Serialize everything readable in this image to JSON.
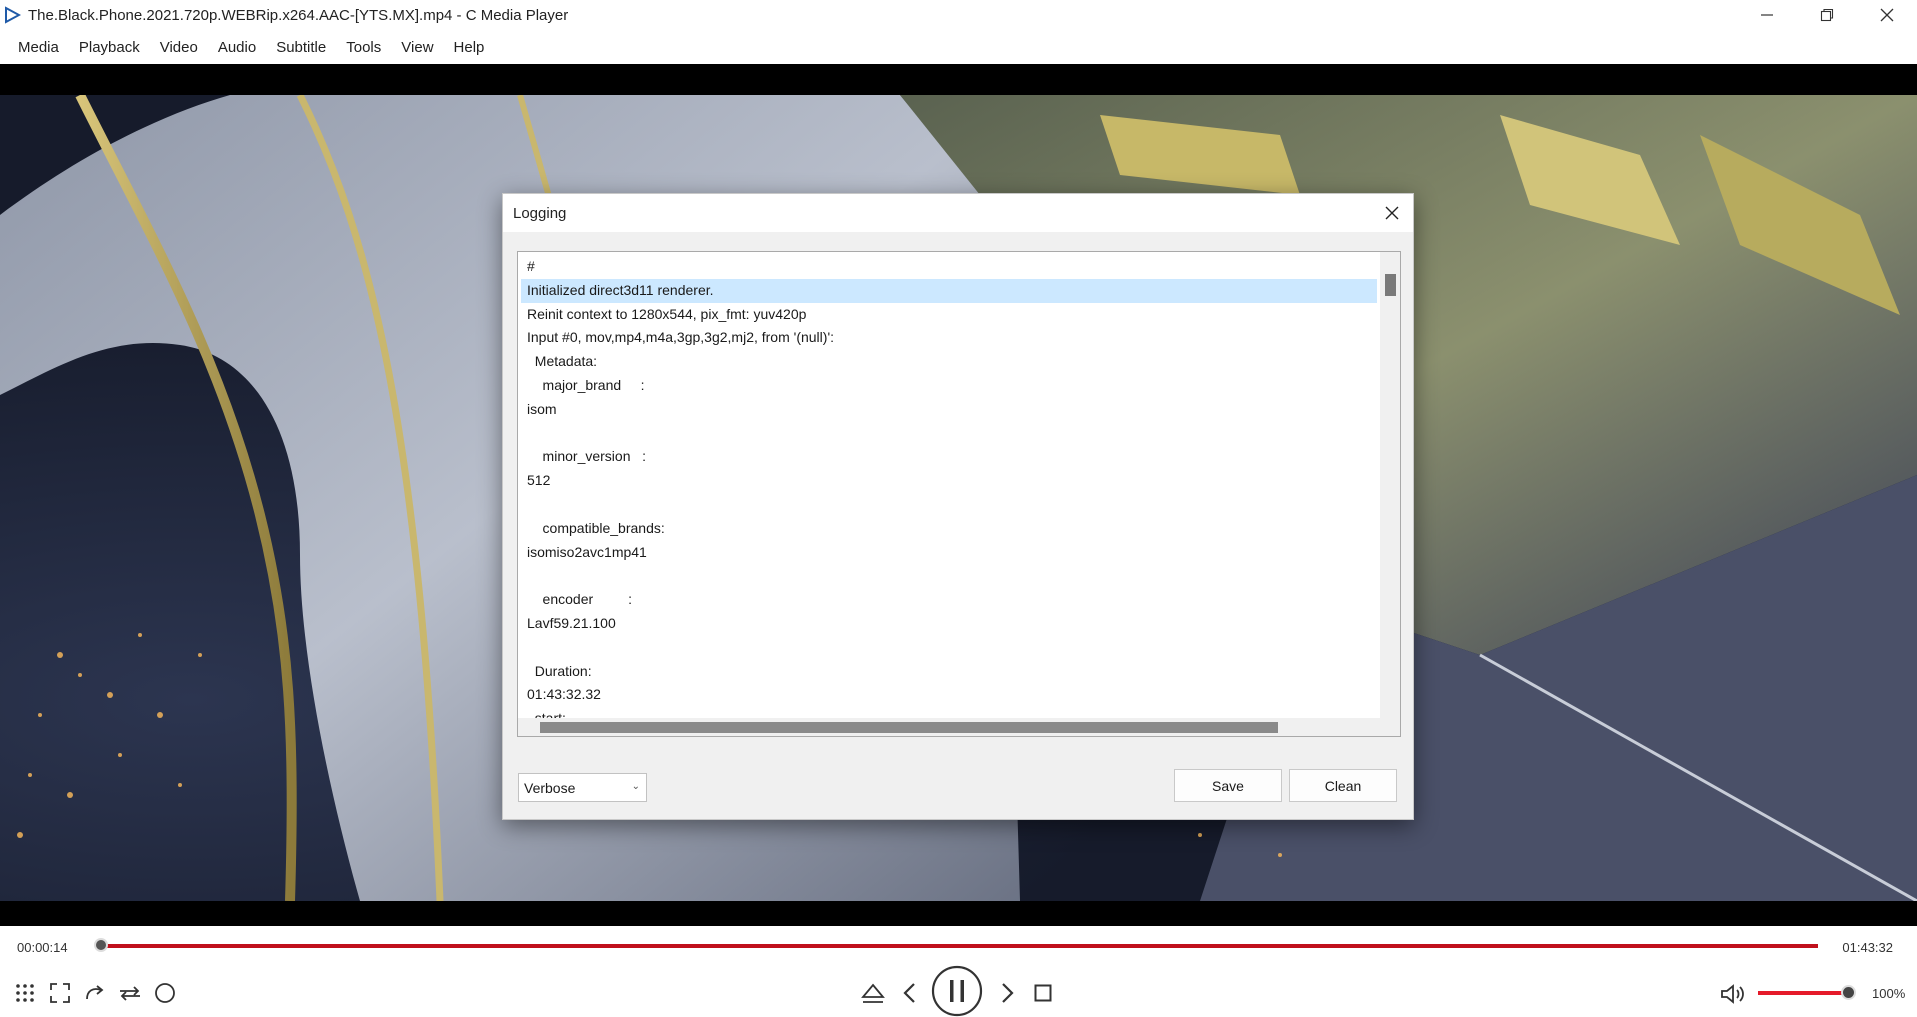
{
  "window": {
    "title": "The.Black.Phone.2021.720p.WEBRip.x264.AAC-[YTS.MX].mp4 - C Media Player",
    "controls": [
      "minimize-icon",
      "restore-icon",
      "close-icon"
    ]
  },
  "menu": {
    "items": [
      {
        "label": "Media"
      },
      {
        "label": "Playback"
      },
      {
        "label": "Video"
      },
      {
        "label": "Audio"
      },
      {
        "label": "Subtitle"
      },
      {
        "label": "Tools"
      },
      {
        "label": "View"
      },
      {
        "label": "Help"
      }
    ]
  },
  "dialog": {
    "title": "Logging",
    "log_lines": [
      "#",
      "Initialized direct3d11 renderer.",
      "Reinit context to 1280x544, pix_fmt: yuv420p",
      "Input #0, mov,mp4,m4a,3gp,3g2,mj2, from '(null)':",
      "  Metadata:",
      "    major_brand     :",
      "isom",
      "",
      "    minor_version   :",
      "512",
      "",
      "    compatible_brands:",
      "isomiso2avc1mp41",
      "",
      "    encoder         :",
      "Lavf59.21.100",
      "",
      "  Duration:",
      "01:43:32.32",
      ", start:"
    ],
    "selected_line": 1,
    "level_select": {
      "value": "Verbose"
    },
    "save_label": "Save",
    "clean_label": "Clean"
  },
  "player": {
    "current_time": "00:00:14",
    "total_time": "01:43:32",
    "progress_fraction": 0.0023,
    "volume_percent": "100%",
    "volume_fraction": 1.0,
    "left_controls": [
      "playlist-grid-icon",
      "fullscreen-icon",
      "redo-icon",
      "repeat-icon",
      "record-icon"
    ],
    "center_controls": [
      "eject-icon",
      "previous-icon",
      "pause-icon",
      "next-icon",
      "stop-icon"
    ],
    "accent_color": "#c0101c"
  }
}
